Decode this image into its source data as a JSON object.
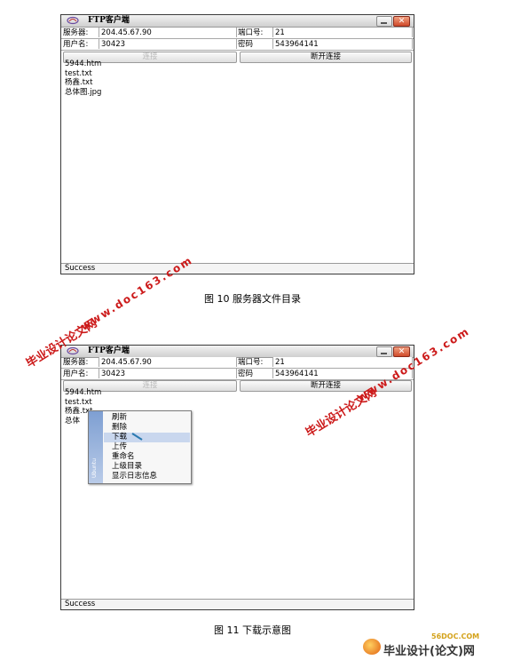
{
  "window1": {
    "title": "FTP客户端",
    "server_label": "服务器:",
    "server_value": "204.45.67.90",
    "port_label": "端口号:",
    "port_value": "21",
    "user_label": "用户名:",
    "user_value": "30423",
    "password_label": "密码",
    "password_value": "543964141",
    "connect_label": "连接",
    "disconnect_label": "断开连接",
    "files": [
      "5944.htm",
      "test.txt",
      "杨鑫.txt",
      "总体图.jpg"
    ],
    "status": "Success"
  },
  "caption1": "图 10 服务器文件目录",
  "window2": {
    "title": "FTP客户端",
    "server_label": "服务器:",
    "server_value": "204.45.67.90",
    "port_label": "端口号:",
    "port_value": "21",
    "user_label": "用户名:",
    "user_value": "30423",
    "password_label": "密码",
    "password_value": "543964141",
    "connect_label": "连接",
    "disconnect_label": "断开连接",
    "files": [
      "5944.htm",
      "test.txt",
      "杨鑫.txt",
      "总体"
    ],
    "status": "Success",
    "context_menu": {
      "items": [
        "刷新",
        "删除",
        "下载",
        "上传",
        "重命名",
        "上级目录",
        "显示日志信息"
      ],
      "highlighted": "下载",
      "side_text": "Ubuntu"
    }
  },
  "caption2": "图 11 下载示意图",
  "watermarks": {
    "site_name": "毕业设计论文网",
    "site_url": "www.doc163.com"
  },
  "footer": {
    "url": "56DOC.COM",
    "text": "毕业设计(论文)网"
  }
}
